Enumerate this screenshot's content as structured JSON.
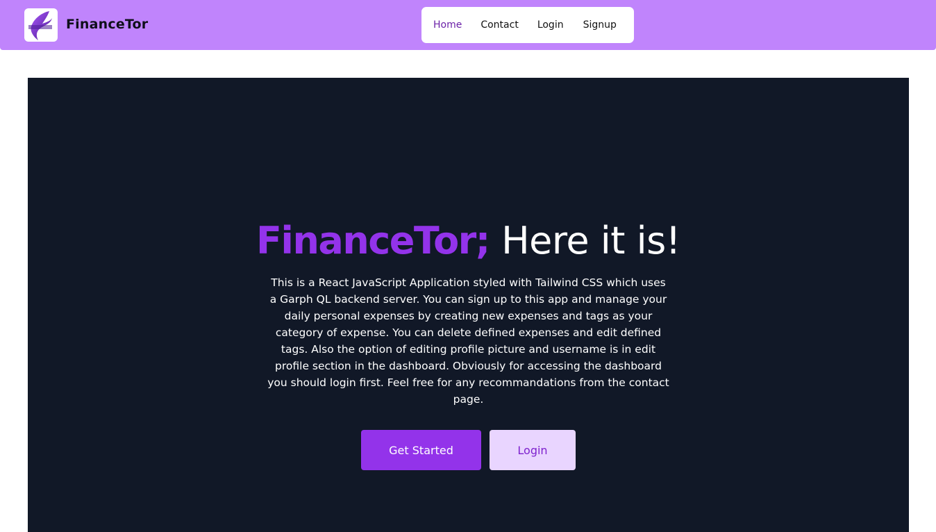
{
  "navbar": {
    "brand_name": "FinanceTor",
    "logo_icon": "financetor-logo-icon",
    "links": [
      {
        "label": "Home",
        "active": true
      },
      {
        "label": "Contact",
        "active": false
      },
      {
        "label": "Login",
        "active": false
      },
      {
        "label": "Signup",
        "active": false
      }
    ],
    "background_color": "#c084fc"
  },
  "hero": {
    "headline_brand": "FinanceTor;",
    "headline_rest": "Here it is!",
    "description": "This is a React JavaScript Application styled with Tailwind CSS which uses a Garph QL backend server. You can sign up to this app and manage your daily personal expenses by creating new expenses and tags as your category of expense. You can delete defined expenses and edit defined tags. Also the option of editing profile picture and username is in edit profile section in the dashboard. Obviously for accessing the dashboard you should login first. Feel free for any recommandations from the contact page.",
    "primary_button_label": "Get Started",
    "secondary_button_label": "Login",
    "background_color": "#111827",
    "accent_color": "#9333ea"
  }
}
